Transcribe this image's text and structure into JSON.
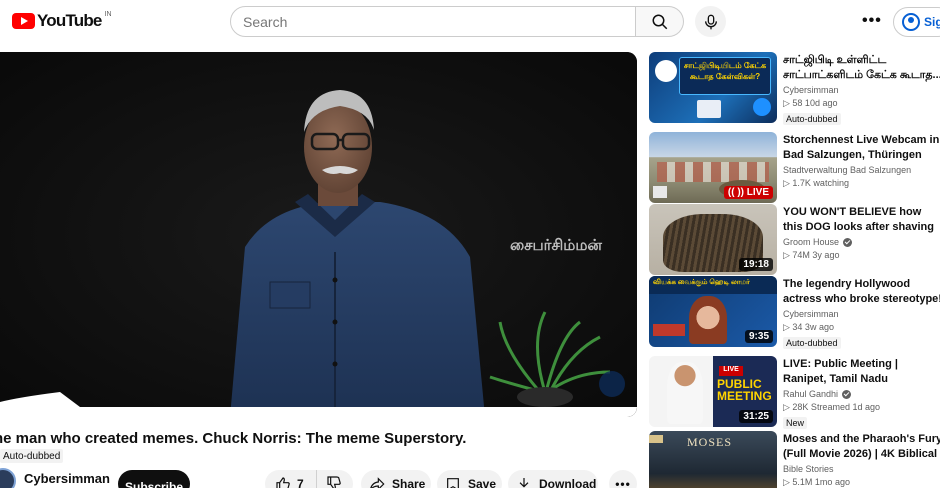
{
  "header": {
    "logo_text": "YouTube",
    "region": "IN",
    "search_placeholder": "Search",
    "signin_label": "Sig"
  },
  "player": {
    "watermark": "சைபர்சிம்மன்"
  },
  "video": {
    "title": "he man who created memes. Chuck Norris: The meme Superstory.",
    "dub_tag": "Auto-dubbed",
    "channel": "Cybersimman",
    "subscribe_label": "Subscribe",
    "likes": "7",
    "share_label": "Share",
    "save_label": "Save",
    "download_label": "Download"
  },
  "recommendations": [
    {
      "title": "சாட்ஜிபிடி உள்ளிட்ட சாட்பாட்களிடம் கேட்க கூடாத...",
      "channel": "Cybersimman",
      "verified": false,
      "meta": "▷ 58  10d ago",
      "badge": "Auto-dubbed",
      "thumb_text": "சாட்ஜிபிடியிடம் கேட்க கூடாத கேள்விகள்?",
      "duration": ""
    },
    {
      "title": "Storchennest Live Webcam in Bad Salzungen, Thüringen",
      "channel": "Stadtverwaltung Bad Salzungen",
      "verified": false,
      "meta": "▷ 1.7K watching",
      "badge": "",
      "live": "LIVE",
      "duration": ""
    },
    {
      "title": "YOU WON'T BELIEVE how this DOG looks after shaving all ...",
      "channel": "Groom House",
      "verified": true,
      "meta": "▷ 74M  3y ago",
      "badge": "",
      "duration": "19:18"
    },
    {
      "title": "The legendry Hollywood actress who broke stereotype!",
      "channel": "Cybersimman",
      "verified": false,
      "meta": "▷ 34  3w ago",
      "badge": "Auto-dubbed",
      "thumb_text": "வியக்க வைக்கும் ஹெடி லாமர்",
      "duration": "9:35"
    },
    {
      "title": "LIVE: Public Meeting | Ranipet, Tamil Nadu",
      "channel": "Rahul Gandhi",
      "verified": true,
      "meta": "▷ 28K  Streamed 1d ago",
      "badge": "New",
      "thumb_text": "PUBLIC MEETING",
      "thumb_tag": "LIVE",
      "duration": "31:25"
    },
    {
      "title": "Moses and the Pharaoh's Fury (Full Movie 2026) | 4K Biblical ...",
      "channel": "Bible Stories",
      "verified": false,
      "meta": "▷ 5.1M  1mo ago",
      "badge": "",
      "thumb_text": "MOSES",
      "duration": ""
    }
  ]
}
